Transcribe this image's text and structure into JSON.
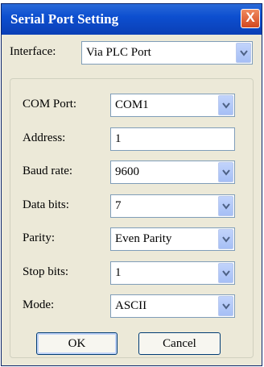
{
  "window": {
    "title": "Serial Port Setting",
    "close_glyph": "X"
  },
  "interface": {
    "label": "Interface:",
    "value": "Via PLC Port"
  },
  "settings": [
    {
      "label": "COM Port:",
      "value": "COM1",
      "type": "dropdown"
    },
    {
      "label": "Address:",
      "value": "1",
      "type": "text"
    },
    {
      "label": "Baud rate:",
      "value": "9600",
      "type": "dropdown"
    },
    {
      "label": "Data bits:",
      "value": "7",
      "type": "dropdown"
    },
    {
      "label": "Parity:",
      "value": "Even Parity",
      "type": "dropdown"
    },
    {
      "label": "Stop bits:",
      "value": "1",
      "type": "dropdown"
    },
    {
      "label": "Mode:",
      "value": "ASCII",
      "type": "dropdown"
    }
  ],
  "buttons": {
    "ok": "OK",
    "cancel": "Cancel"
  },
  "colors": {
    "titlebar": "#0d4fd0",
    "dialog_bg": "#ece9d8",
    "close_button": "#d2471f",
    "field_border": "#7f9db9"
  },
  "icons": {
    "dropdown": "chevron-down-icon",
    "close": "close-icon"
  }
}
